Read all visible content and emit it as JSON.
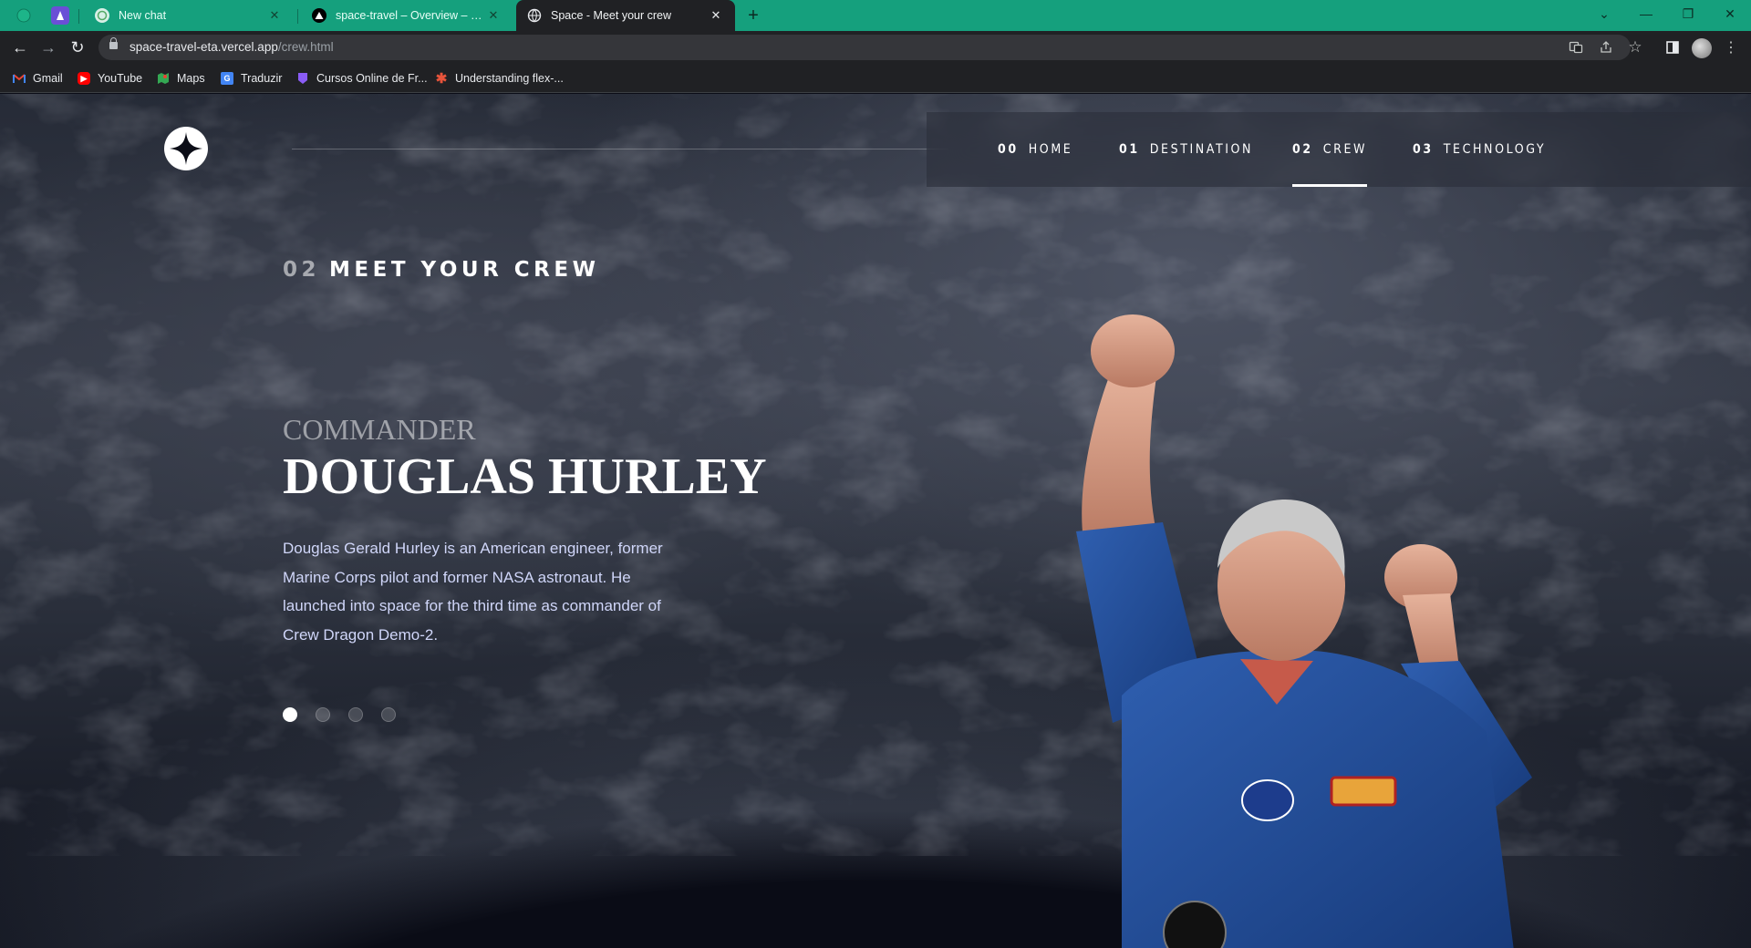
{
  "browser": {
    "tabs": [
      {
        "title": "New chat",
        "active": false
      },
      {
        "title": "space-travel – Overview – Vercel",
        "active": false
      },
      {
        "title": "Space - Meet your crew",
        "active": true
      }
    ],
    "new_tab_symbol": "+",
    "url": {
      "domain": "space-travel-eta.vercel.app",
      "path": "/crew.html"
    },
    "bookmarks": [
      {
        "label": "Gmail",
        "icon": "gmail-icon"
      },
      {
        "label": "YouTube",
        "icon": "youtube-icon"
      },
      {
        "label": "Maps",
        "icon": "maps-icon"
      },
      {
        "label": "Traduzir",
        "icon": "translate-icon"
      },
      {
        "label": "Cursos Online de Fr...",
        "icon": "course-icon"
      },
      {
        "label": "Understanding flex-...",
        "icon": "asterisk-icon"
      }
    ],
    "accent_color": "#15a07d"
  },
  "nav": {
    "items": [
      {
        "number": "00",
        "label": "HOME"
      },
      {
        "number": "01",
        "label": "DESTINATION"
      },
      {
        "number": "02",
        "label": "CREW"
      },
      {
        "number": "03",
        "label": "TECHNOLOGY"
      }
    ],
    "active_index": 2
  },
  "page": {
    "heading_number": "02",
    "heading_text": "MEET YOUR CREW",
    "role": "COMMANDER",
    "name": "DOUGLAS HURLEY",
    "bio": "Douglas Gerald Hurley is an American engineer, former Marine Corps pilot and former NASA astronaut. He launched into space for the third time as commander of Crew Dragon Demo-2.",
    "slides": 4,
    "active_slide": 0
  }
}
